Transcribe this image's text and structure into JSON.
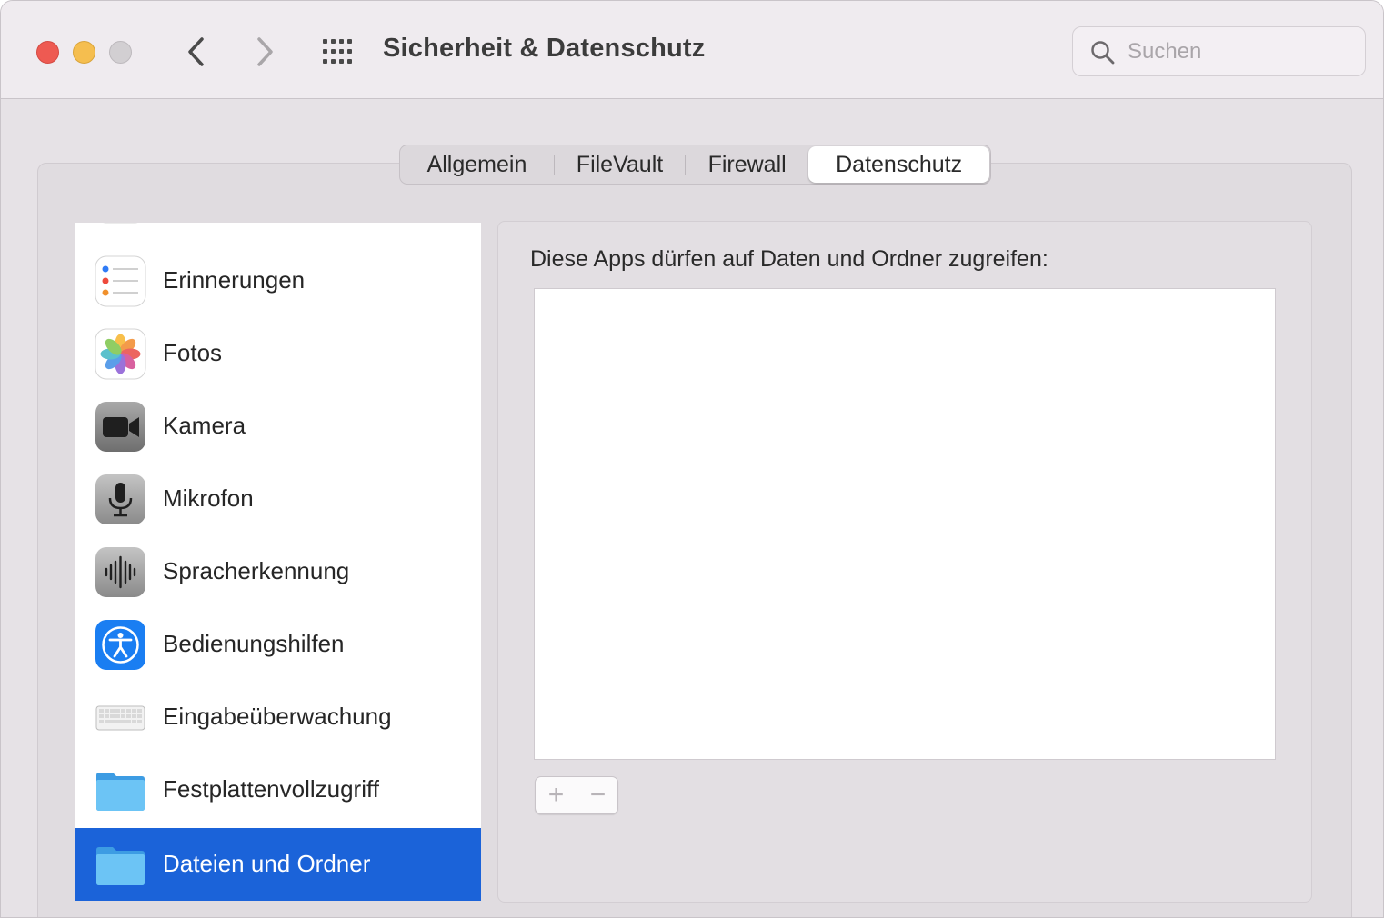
{
  "window": {
    "title": "Sicherheit & Datenschutz"
  },
  "search": {
    "placeholder": "Suchen",
    "value": ""
  },
  "tabs": [
    {
      "label": "Allgemein",
      "selected": false
    },
    {
      "label": "FileVault",
      "selected": false
    },
    {
      "label": "Firewall",
      "selected": false
    },
    {
      "label": "Datenschutz",
      "selected": true
    }
  ],
  "sidebar": {
    "items": [
      {
        "label": "Erinnerungen",
        "icon": "reminders-icon"
      },
      {
        "label": "Fotos",
        "icon": "photos-icon"
      },
      {
        "label": "Kamera",
        "icon": "camera-icon"
      },
      {
        "label": "Mikrofon",
        "icon": "microphone-icon"
      },
      {
        "label": "Spracherkennung",
        "icon": "speech-recognition-icon"
      },
      {
        "label": "Bedienungshilfen",
        "icon": "accessibility-icon"
      },
      {
        "label": "Eingabeüberwachung",
        "icon": "keyboard-icon"
      },
      {
        "label": "Festplattenvollzugriff",
        "icon": "folder-icon"
      },
      {
        "label": "Dateien und Ordner",
        "icon": "folder-icon",
        "selected": true
      }
    ]
  },
  "panel": {
    "heading": "Diese Apps dürfen auf Daten und Ordner zugreifen:",
    "plus_label": "+",
    "minus_label": "−"
  },
  "colors": {
    "accent": "#1b63d9",
    "close": "#ee5a52",
    "minimize": "#f5be4f"
  }
}
